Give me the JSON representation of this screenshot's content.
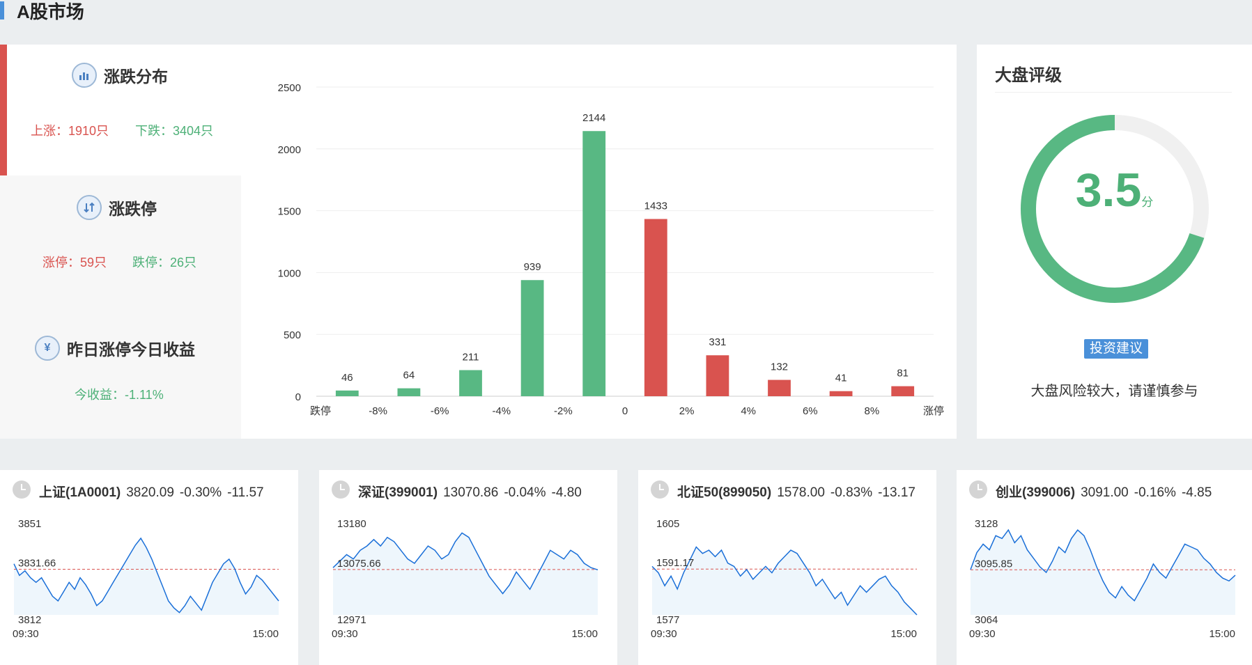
{
  "header": {
    "title": "A股市场"
  },
  "distribution": {
    "title": "涨跌分布",
    "icon": "bar-chart-icon",
    "up_text": "上涨：1910只",
    "down_text": "下跌：3404只"
  },
  "limit": {
    "title": "涨跌停",
    "icon": "up-down-arrows-icon",
    "up_text": "涨停：59只",
    "down_text": "跌停：26只"
  },
  "yesterday": {
    "title": "昨日涨停今日收益",
    "icon": "yen-icon",
    "yen_glyph": "¥",
    "income_text": "今收益：-1.11%"
  },
  "chart_data": {
    "type": "bar",
    "categories": [
      "跌停",
      "-8%",
      "-6%",
      "-4%",
      "-2%",
      "0",
      "2%",
      "4%",
      "6%",
      "8%",
      "涨停"
    ],
    "bars": [
      {
        "value": 46,
        "color": "down"
      },
      {
        "value": 64,
        "color": "down"
      },
      {
        "value": 211,
        "color": "down"
      },
      {
        "value": 939,
        "color": "down"
      },
      {
        "value": 2144,
        "color": "down"
      },
      {
        "value": 1433,
        "color": "up"
      },
      {
        "value": 331,
        "color": "up"
      },
      {
        "value": 132,
        "color": "up"
      },
      {
        "value": 41,
        "color": "up"
      },
      {
        "value": 81,
        "color": "up"
      }
    ],
    "yticks": [
      0,
      500,
      1000,
      1500,
      2000,
      2500
    ],
    "ylim": [
      0,
      2500
    ],
    "grid": true,
    "colors": {
      "up": "#d9534f",
      "down": "#58b883"
    }
  },
  "rating": {
    "title": "大盘评级",
    "score": "3.5",
    "unit": "分",
    "score_fraction": 0.7,
    "advice_label": "投资建议",
    "advice_text": "大盘风险较大，请谨慎参与"
  },
  "indices": [
    {
      "name": "上证(1A0001)",
      "price": "3820.09",
      "pct": "-0.30%",
      "chg": "-11.57",
      "high": "3851",
      "prev": "3831.66",
      "low": "3812",
      "time_start": "09:30",
      "time_end": "15:00",
      "series": [
        3834,
        3829,
        3831,
        3828,
        3826,
        3828,
        3824,
        3820,
        3818,
        3822,
        3826,
        3823,
        3828,
        3825,
        3821,
        3816,
        3818,
        3822,
        3826,
        3830,
        3834,
        3838,
        3842,
        3845,
        3841,
        3836,
        3830,
        3824,
        3818,
        3815,
        3813,
        3816,
        3820,
        3817,
        3814,
        3820,
        3826,
        3830,
        3834,
        3836,
        3832,
        3826,
        3821,
        3824,
        3829,
        3827,
        3824,
        3821,
        3818
      ]
    },
    {
      "name": "深证(399001)",
      "price": "13070.86",
      "pct": "-0.04%",
      "chg": "-4.80",
      "high": "13180",
      "prev": "13075.66",
      "low": "12971",
      "time_start": "09:30",
      "time_end": "15:00",
      "series": [
        13080,
        13095,
        13110,
        13100,
        13120,
        13130,
        13145,
        13130,
        13150,
        13140,
        13120,
        13100,
        13090,
        13110,
        13130,
        13120,
        13100,
        13110,
        13140,
        13160,
        13150,
        13120,
        13090,
        13060,
        13040,
        13020,
        13040,
        13070,
        13050,
        13030,
        13060,
        13090,
        13120,
        13110,
        13100,
        13120,
        13110,
        13090,
        13080,
        13075
      ]
    },
    {
      "name": "北证50(899050)",
      "price": "1578.00",
      "pct": "-0.83%",
      "chg": "-13.17",
      "high": "1605",
      "prev": "1591.17",
      "low": "1577",
      "time_start": "09:30",
      "time_end": "15:00",
      "series": [
        1592,
        1590,
        1586,
        1589,
        1585,
        1590,
        1594,
        1598,
        1596,
        1597,
        1595,
        1597,
        1593,
        1592,
        1589,
        1591,
        1588,
        1590,
        1592,
        1590,
        1593,
        1595,
        1597,
        1596,
        1593,
        1590,
        1586,
        1588,
        1585,
        1582,
        1584,
        1580,
        1583,
        1586,
        1584,
        1586,
        1588,
        1589,
        1586,
        1584,
        1581,
        1579,
        1577
      ]
    },
    {
      "name": "创业(399006)",
      "price": "3091.00",
      "pct": "-0.16%",
      "chg": "-4.85",
      "high": "3128",
      "prev": "3095.85",
      "low": "3064",
      "time_start": "09:30",
      "time_end": "15:00",
      "series": [
        3096,
        3108,
        3114,
        3110,
        3120,
        3118,
        3124,
        3115,
        3120,
        3110,
        3104,
        3098,
        3094,
        3102,
        3112,
        3108,
        3118,
        3124,
        3120,
        3110,
        3098,
        3088,
        3080,
        3076,
        3084,
        3078,
        3074,
        3082,
        3090,
        3100,
        3094,
        3090,
        3098,
        3106,
        3114,
        3112,
        3110,
        3104,
        3100,
        3094,
        3090,
        3088,
        3092
      ]
    }
  ]
}
